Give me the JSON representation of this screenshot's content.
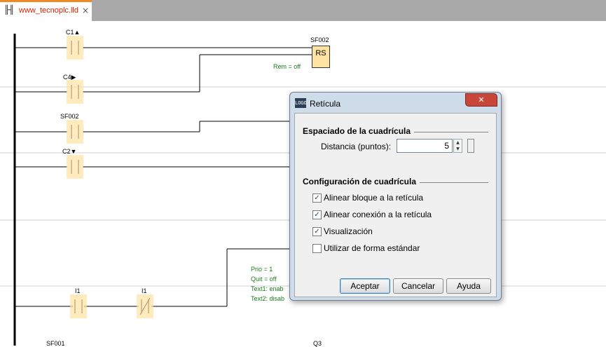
{
  "tab": {
    "title": "www_tecnoplc.lld",
    "icon": "ladder-icon",
    "close": "×"
  },
  "ladder": {
    "c1_label": "C1▲",
    "c4_label": "C4▶",
    "sf002_label": "SF002",
    "c2_label": "C2▼",
    "i1a_label": "I1",
    "i1b_label": "I1",
    "sf002_block_label": "SF002",
    "rs_label": "RS",
    "rem_label": "Rem = off",
    "prio_label": "Prio = 1",
    "quit_label": "Quit = off",
    "text1_label": "Text1: enab",
    "text2_label": "Text2: disab",
    "sf001_label": "SF001",
    "q3_label": "Q3"
  },
  "dialog": {
    "title": "Retícula",
    "close": "✕",
    "section1": "Espaciado de la cuadrícula",
    "distance_label": "Distancia (puntos):",
    "distance_value": "5",
    "section2": "Configuración de cuadrícula",
    "checkboxes": [
      {
        "label": "Alinear bloque a la retícula",
        "checked": "✓"
      },
      {
        "label": "Alinear conexión a la retícula",
        "checked": "✓"
      },
      {
        "label": "Visualización",
        "checked": "✓"
      },
      {
        "label": "Utilizar de forma estándar",
        "checked": ""
      }
    ],
    "buttons": {
      "ok": "Aceptar",
      "cancel": "Cancelar",
      "help": "Ayuda"
    }
  }
}
